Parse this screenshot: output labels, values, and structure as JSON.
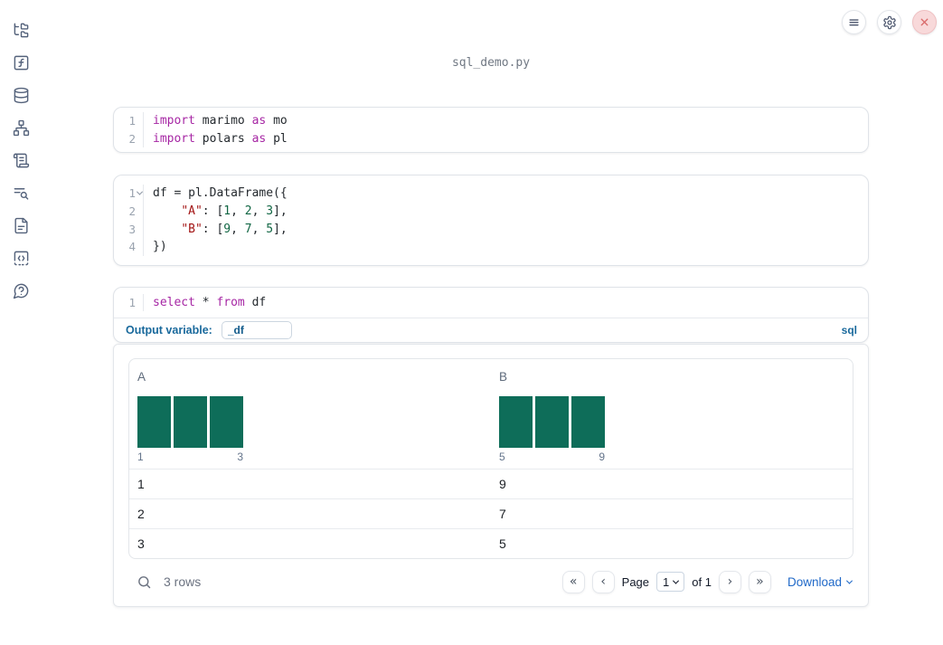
{
  "colors": {
    "accent_blue": "#19699c",
    "link_blue": "#2069c8",
    "histogram_bar": "#0e6d59",
    "syntax_keyword": "#a626a4",
    "syntax_string": "#a31515",
    "syntax_number": "#116644",
    "close_red": "#d96a6a"
  },
  "sidebar": {
    "icons": [
      "file-tree",
      "helper-functions",
      "datasources",
      "dependency-graph",
      "scratchpad",
      "logs",
      "documentation",
      "snippets",
      "help"
    ]
  },
  "topbar": {
    "icons": [
      "menu",
      "settings",
      "close"
    ]
  },
  "notebook": {
    "filename": "sql_demo.py"
  },
  "cells": [
    {
      "type": "python",
      "lines": [
        {
          "n": "1",
          "code": [
            [
              "kw",
              "import"
            ],
            [
              "pl",
              " marimo "
            ],
            [
              "kw",
              "as"
            ],
            [
              "pl",
              " mo"
            ]
          ]
        },
        {
          "n": "2",
          "code": [
            [
              "kw",
              "import"
            ],
            [
              "pl",
              " polars "
            ],
            [
              "kw",
              "as"
            ],
            [
              "pl",
              " pl"
            ]
          ]
        }
      ]
    },
    {
      "type": "python",
      "lines": [
        {
          "n": "1",
          "fold": true,
          "code": [
            [
              "pl",
              "df = pl.DataFrame({"
            ]
          ]
        },
        {
          "n": "2",
          "code": [
            [
              "pl",
              "    "
            ],
            [
              "str",
              "\"A\""
            ],
            [
              "pl",
              ": ["
            ],
            [
              "num",
              "1"
            ],
            [
              "pl",
              ", "
            ],
            [
              "num",
              "2"
            ],
            [
              "pl",
              ", "
            ],
            [
              "num",
              "3"
            ],
            [
              "pl",
              "],"
            ]
          ]
        },
        {
          "n": "3",
          "code": [
            [
              "pl",
              "    "
            ],
            [
              "str",
              "\"B\""
            ],
            [
              "pl",
              ": ["
            ],
            [
              "num",
              "9"
            ],
            [
              "pl",
              ", "
            ],
            [
              "num",
              "7"
            ],
            [
              "pl",
              ", "
            ],
            [
              "num",
              "5"
            ],
            [
              "pl",
              "],"
            ]
          ]
        },
        {
          "n": "4",
          "code": [
            [
              "pl",
              "})"
            ]
          ]
        }
      ]
    },
    {
      "type": "sql",
      "lines": [
        {
          "n": "1",
          "code": [
            [
              "kw",
              "select"
            ],
            [
              "pl",
              " * "
            ],
            [
              "kw",
              "from"
            ],
            [
              "pl",
              " df"
            ]
          ]
        }
      ],
      "output_variable_label": "Output variable:",
      "output_variable_value": "_df",
      "language_badge": "sql"
    }
  ],
  "table": {
    "columns": [
      {
        "name": "A",
        "hist": {
          "bars": [
            1,
            1,
            1
          ],
          "min_label": "1",
          "max_label": "3"
        }
      },
      {
        "name": "B",
        "hist": {
          "bars": [
            1,
            1,
            1
          ],
          "min_label": "5",
          "max_label": "9"
        }
      }
    ],
    "rows": [
      [
        "1",
        "9"
      ],
      [
        "2",
        "7"
      ],
      [
        "3",
        "5"
      ]
    ],
    "footer": {
      "row_count": "3 rows",
      "first_page_icon": "«",
      "prev_page_icon": "‹",
      "page_label": "Page",
      "page_value": "1",
      "page_total": "of 1",
      "next_page_icon": "›",
      "last_page_icon": "»",
      "download_label": "Download"
    }
  }
}
